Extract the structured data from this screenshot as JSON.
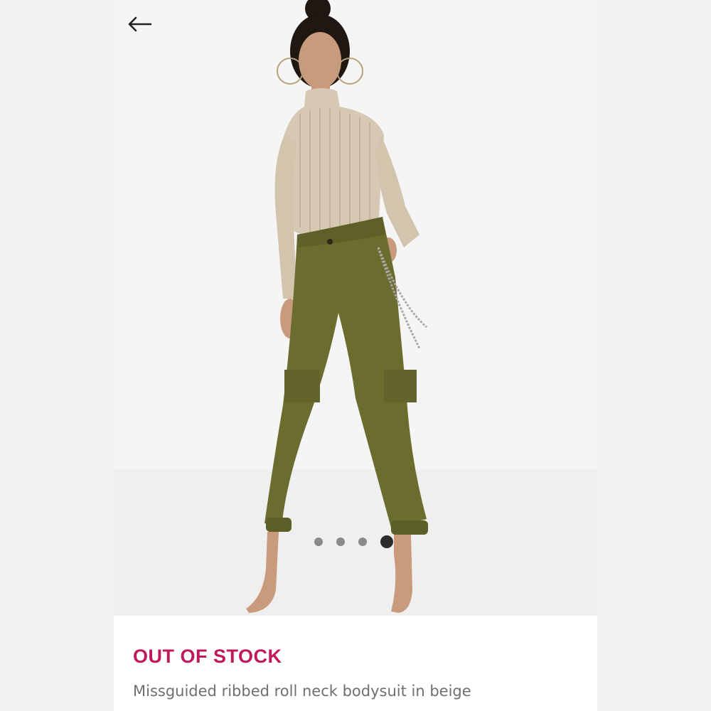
{
  "navigation": {
    "back_icon": "arrow-left-icon"
  },
  "gallery": {
    "image_count": 4,
    "active_index": 4,
    "image_alt": "Model wearing beige ribbed roll neck bodysuit with olive cargo trousers"
  },
  "product": {
    "stock_status": "OUT OF STOCK",
    "name": "Missguided ribbed roll neck bodysuit in beige"
  },
  "colors": {
    "accent": "#c0185a",
    "text_secondary": "#6f6f6f",
    "bodysuit": "#d6c8b2",
    "trousers": "#6b6d2f"
  }
}
